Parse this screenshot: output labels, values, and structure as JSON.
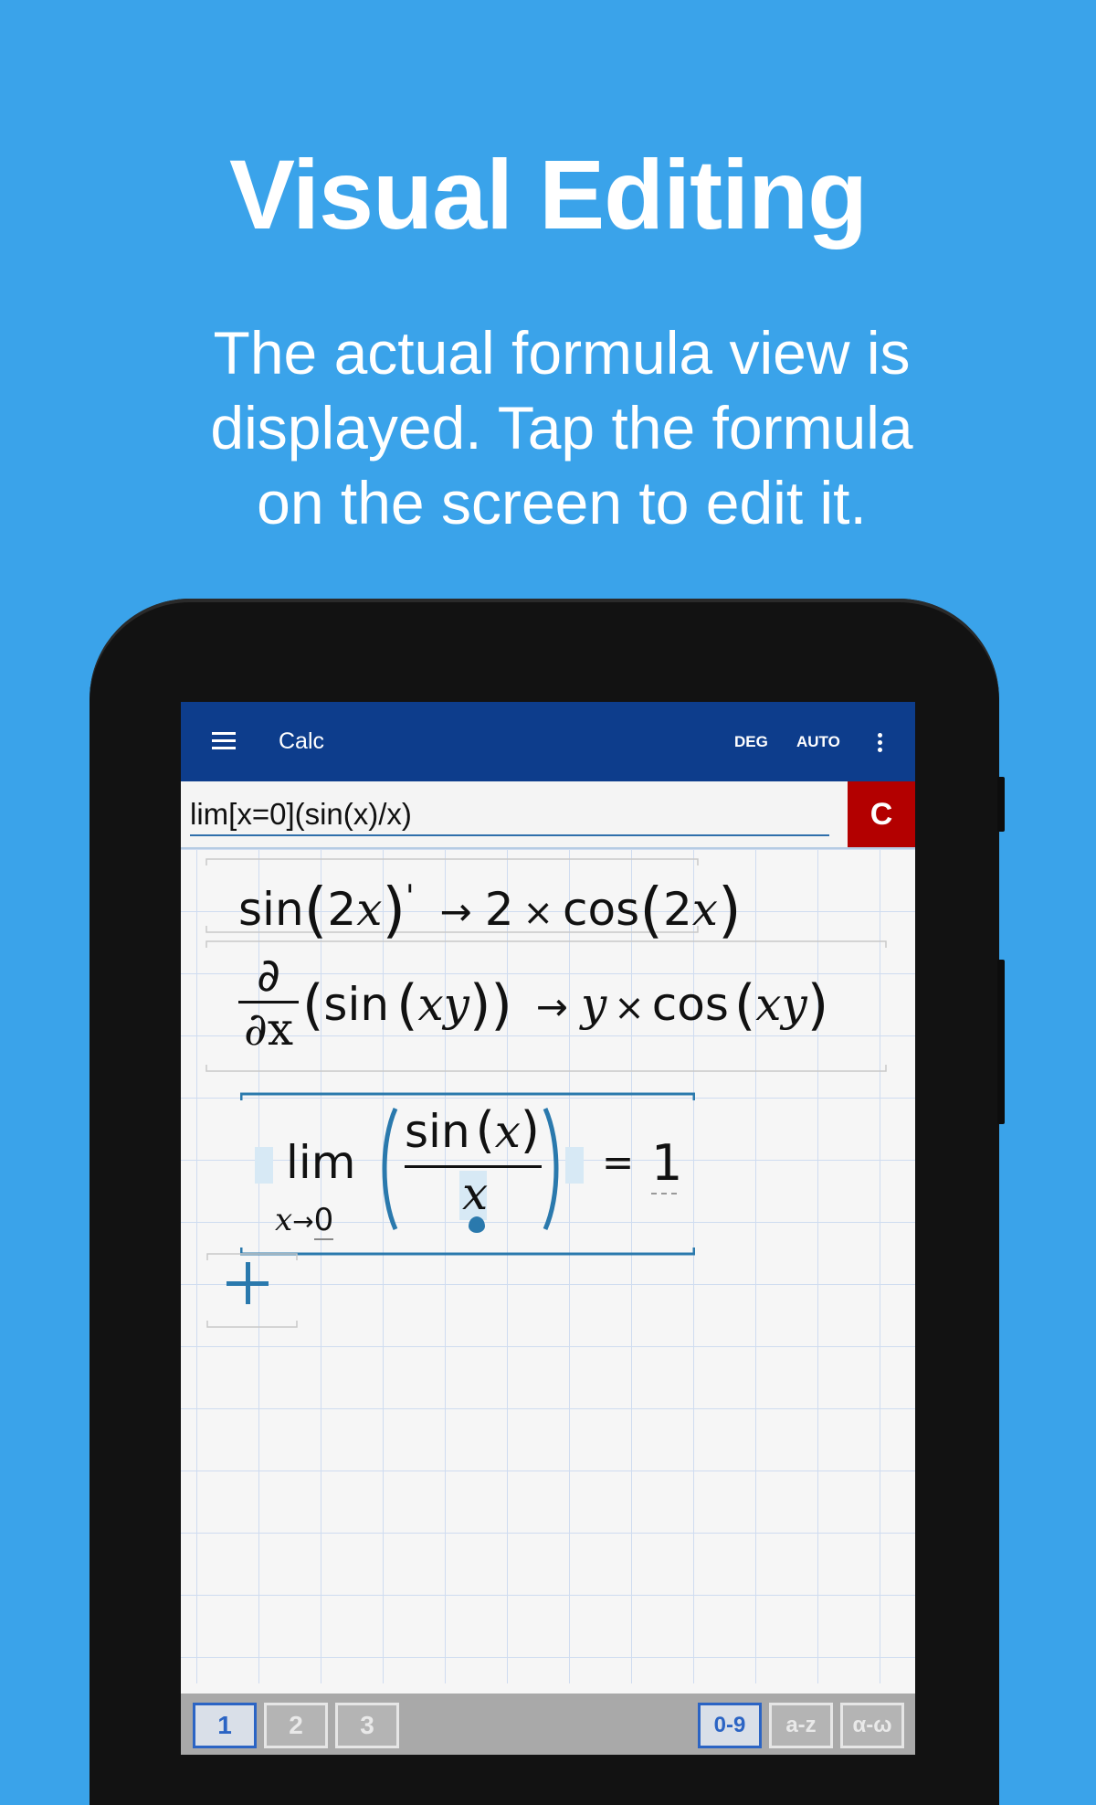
{
  "promo": {
    "title": "Visual Editing",
    "subtitle_lines": [
      "The actual formula view is",
      "displayed. Tap the formula",
      "on the screen to edit it."
    ]
  },
  "appbar": {
    "title": "Calc",
    "menu_icon": "hamburger-icon",
    "deg_label": "DEG",
    "auto_label": "AUTO",
    "more_icon": "more-vertical-icon"
  },
  "input": {
    "value": "lim[x=0](sin(x)/x)",
    "clear_label": "C"
  },
  "formulas": {
    "f1": {
      "sin": "sin",
      "arg_num": "2",
      "arg_var": "x",
      "prime": "'",
      "arrow": "→",
      "coef": "2",
      "times": "×",
      "cos": "cos",
      "res_num": "2",
      "res_var": "x"
    },
    "f2": {
      "partial_top": "∂",
      "partial_bottom": "∂x",
      "sin": "sin",
      "var": "xy",
      "arrow": "→",
      "y": "y",
      "times": "×",
      "cos": "cos",
      "res_var": "xy"
    },
    "f3": {
      "lim": "lim",
      "sub_var": "x",
      "sub_arrow": "→",
      "sub_val": "0",
      "num_fn": "sin",
      "num_var": "x",
      "den_var": "x",
      "equals": "=",
      "result": "1"
    }
  },
  "add_icon": "plus-icon",
  "keyboard": {
    "pages": [
      "1",
      "2",
      "3"
    ],
    "modes": [
      "0-9",
      "a-z",
      "α-ω"
    ],
    "active_page": "1",
    "active_mode": "0-9"
  },
  "colors": {
    "background": "#3aa3ea",
    "appbar": "#0d3d8c",
    "clear": "#b30000",
    "accent": "#2a79ad"
  }
}
